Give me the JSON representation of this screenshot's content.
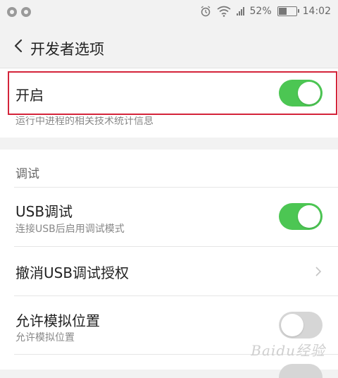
{
  "status_bar": {
    "battery": "52%",
    "battery_level": 0.52,
    "time": "14:02",
    "icons": [
      "notification-app-icon",
      "notification-app-icon",
      "alarm-icon",
      "wifi-icon",
      "signal-icon",
      "battery-icon"
    ]
  },
  "header": {
    "title": "开发者选项"
  },
  "master": {
    "label": "开启",
    "enabled": true,
    "partial_text": "运行中进程的相关技术统计信息"
  },
  "debug_section": {
    "label": "调试",
    "items": [
      {
        "title": "USB调试",
        "subtitle": "连接USB后启用调试模式",
        "control": "switch",
        "on": true
      },
      {
        "title": "撤消USB调试授权",
        "control": "chevron"
      },
      {
        "title": "允许模拟位置",
        "subtitle": "允许模拟位置",
        "control": "switch",
        "on": false
      }
    ]
  },
  "watermark": "Baidu经验",
  "colors": {
    "switch_on": "#4cc653",
    "switch_off": "#d6d6d6",
    "highlight": "#d4243a"
  }
}
